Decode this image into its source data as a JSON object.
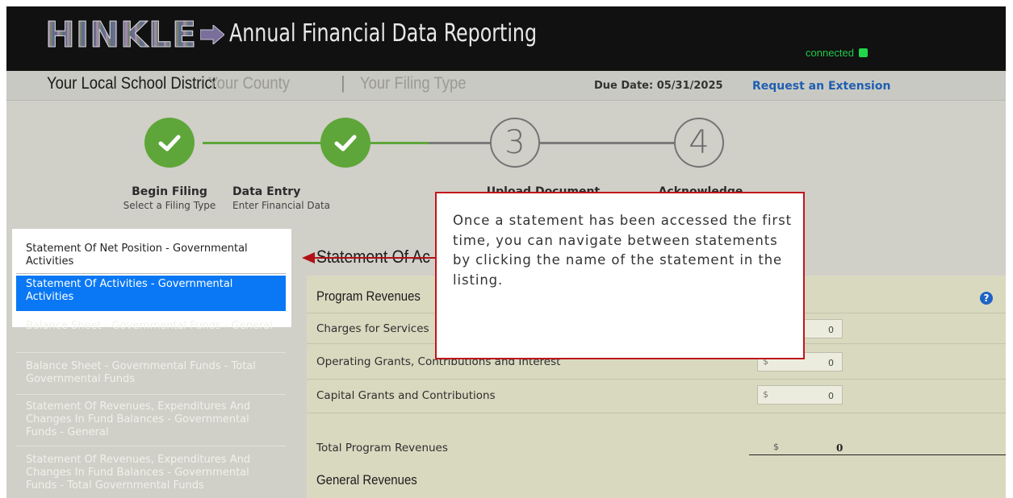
{
  "header": {
    "logo_text": "HINKLE",
    "app_title": "Annual Financial Data Reporting",
    "connection_status": "connected",
    "connection_color": "#21d64a"
  },
  "subheader": {
    "district": "Your Local School District",
    "county": "Your County",
    "separator": "|",
    "filing_type": "Your Filing Type",
    "due_date": "Due Date: 05/31/2025",
    "extension_link": "Request an Extension"
  },
  "steps": [
    {
      "number": "",
      "title": "Begin Filing",
      "subtitle": "Select a Filing Type",
      "status": "complete",
      "icon": "check-icon"
    },
    {
      "number": "",
      "title": "Data Entry",
      "subtitle": "Enter Financial Data",
      "status": "complete",
      "icon": "check-icon"
    },
    {
      "number": "3",
      "title": "Upload Document",
      "subtitle": "",
      "status": "pending"
    },
    {
      "number": "4",
      "title": "Acknowledge",
      "subtitle": "",
      "status": "pending"
    }
  ],
  "sidebar": {
    "items": [
      {
        "label": "Statement Of Net Position - Governmental Activities",
        "state": "visited"
      },
      {
        "label": "Statement Of Activities - Governmental Activities",
        "state": "active"
      },
      {
        "label": "Balance Sheet - Governmental Funds - General",
        "state": "unvisited"
      },
      {
        "label": "Balance Sheet - Governmental Funds - Total Governmental Funds",
        "state": "unvisited"
      },
      {
        "label": "Statement Of Revenues, Expenditures And Changes In Fund Balances - Governmental Funds - General",
        "state": "unvisited"
      },
      {
        "label": "Statement Of Revenues, Expenditures And Changes In Fund Balances - Governmental Funds - Total Governmental Funds",
        "state": "unvisited"
      }
    ]
  },
  "main": {
    "statement_title": "Statement Of Ac",
    "sections": {
      "program_revenues": "Program Revenues",
      "general_revenues": "General Revenues"
    },
    "rows": [
      {
        "label": "Charges for Services",
        "currency": "",
        "value": "0"
      },
      {
        "label": "Operating Grants, Contributions and Interest",
        "currency": "$",
        "value": "0"
      },
      {
        "label": "Capital Grants and Contributions",
        "currency": "$",
        "value": "0"
      }
    ],
    "total": {
      "label": "Total Program Revenues",
      "currency": "$",
      "value": "0"
    },
    "help_glyph": "?"
  },
  "callout": {
    "text": "Once a statement has been accessed the first time, you can navigate between statements by clicking the name of the statement in the listing.",
    "border_color": "#c0161b"
  },
  "colors": {
    "step_complete": "#5ea639",
    "active_item": "#0a78f5",
    "link": "#1f5fb0"
  }
}
